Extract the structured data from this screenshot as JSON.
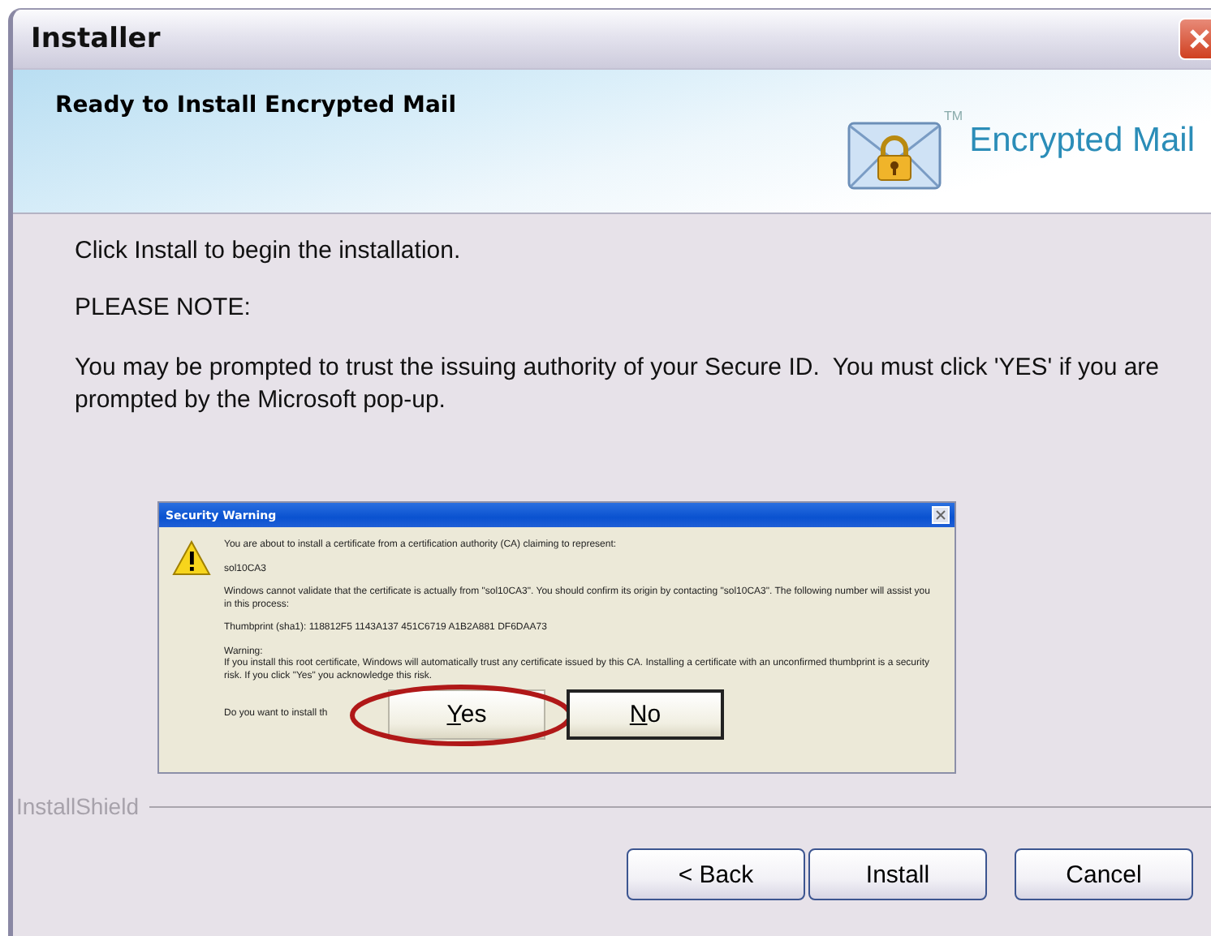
{
  "window": {
    "title": "Installer"
  },
  "header": {
    "title": "Ready to Install Encrypted Mail",
    "logo_text": "Encrypted Mail",
    "logo_mark": "TM"
  },
  "body": {
    "intro": "Click Install to begin the installation.",
    "note_heading": "PLEASE NOTE:",
    "note": "You may be prompted to trust the issuing authority of your Secure ID.  You must click 'YES' if you are prompted by the Microsoft pop-up."
  },
  "example_dialog": {
    "title": "Security Warning",
    "paragraphs": [
      "You are about to install a certificate from a certification authority (CA) claiming to represent:",
      "sol10CA3",
      "Windows cannot validate that the certificate is actually from \"sol10CA3\". You should confirm its origin by contacting \"sol10CA3\". The following number will assist you in this process:",
      "Thumbprint (sha1): 118812F5 1143A137 451C6719 A1B2A881 DF6DAA73",
      "Warning:",
      "If you install this root certificate, Windows will automatically trust any certificate issued by this CA. Installing a certificate with an unconfirmed thumbprint is a security risk. If you click \"Yes\" you acknowledge this risk."
    ],
    "prompt": "Do you want to install th",
    "buttons": [
      {
        "label": "Yes",
        "highlighted": true
      },
      {
        "label": "No",
        "highlighted": false
      }
    ]
  },
  "footer": {
    "brand": "InstallShield"
  },
  "buttons": [
    {
      "label": "< Back"
    },
    {
      "label": "Install"
    },
    {
      "label": "Cancel"
    }
  ]
}
